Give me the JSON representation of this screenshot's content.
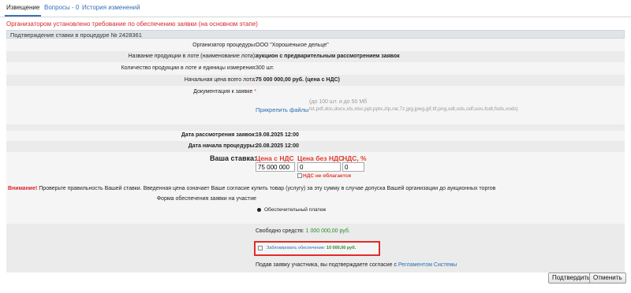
{
  "tabs": [
    {
      "label": "Извещение",
      "active": true
    },
    {
      "label": "Вопросы - 0",
      "active": false
    },
    {
      "label": "История изменений",
      "active": false
    }
  ],
  "notice": "Организатором установлено требование по обеспечению заявки (на основном этапе)",
  "header": "Подтверждение ставки в процедуре № 2428361",
  "fields": {
    "organizer": {
      "label": "Организатор процедуры:",
      "value": "ООО \"Хорошенькое дельце\""
    },
    "lot_name": {
      "label": "Название продукции в лоте (наименование лота):",
      "value": "аукцион с предварительным рассмотрением заявок"
    },
    "quantity": {
      "label": "Количество продукции в лоте и единицы измерения:",
      "value": "300 шт."
    },
    "start_price": {
      "label": "Начальная цена всего лота:",
      "value": "75 000 000,00 руб. (цена с НДС)"
    },
    "documents": {
      "label": "Документация к заявке",
      "required": "*"
    },
    "attach": {
      "label": "Прикрепить файлы",
      "limit": "(до 100 шт. и до 50 Мб",
      "types": "txt,pdf,doc,docx,xls,xlsx,ppt,pptx,zip,rar,7z,jpg,jpeg,gif,tif,png,odt,ods,odf,uos,fodt,fods,xods)"
    },
    "review_date": {
      "label": "Дата рассмотрения заявок:",
      "value": "19.08.2025 12:00"
    },
    "start_date": {
      "label": "Дата начала процедуры:",
      "value": "20.08.2025 12:00"
    }
  },
  "bid": {
    "label": "Ваша ставка:",
    "price_with_vat_label": "Цена с НДС",
    "price_without_vat_label": "Цена без НДС",
    "vat_percent_label": "НДС, %",
    "price_with_vat": "75 000 000",
    "price_without_vat": "0",
    "vat_percent": "0",
    "no_vat_label": "НДС не облагается",
    "no_vat_checked": false
  },
  "warning": {
    "prefix": "Внимание!",
    "text": " Проверьте правильность Вашей ставки. Введенная цена означает Ваше согласие купить товар (услугу) за эту сумму в случае допуска Вашей организации до аукционных торгов"
  },
  "security": {
    "label": "Форма обеспечения заявки на участие",
    "option": "Обеспечительный платеж",
    "free_funds_label": "Свободно средств: ",
    "free_funds_value": "1 000 000,00 руб.",
    "block_label": "Заблокировать обеспечение: ",
    "block_value": "10 000,00 руб.",
    "block_checked": false
  },
  "agreement": {
    "text": "Подав заявку участника, вы подтверждаете согласие с ",
    "link": "Регламентом Системы"
  },
  "buttons": {
    "confirm": "Подтвердить",
    "cancel": "Отменить"
  },
  "colors": {
    "link": "#2a6fb5",
    "warning": "#d9262c",
    "highlight_box": "#e22b2b",
    "funds": "#2c8a2e"
  }
}
